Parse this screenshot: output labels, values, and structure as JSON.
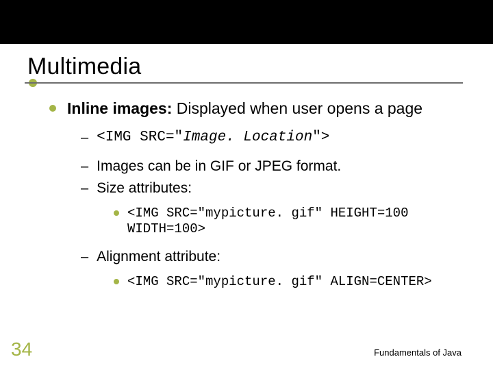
{
  "title": "Multimedia",
  "bullet1": {
    "label": "Inline images:",
    "rest": " Displayed when user opens a page"
  },
  "sub1": {
    "pre": "<IMG SRC=\"",
    "ital": "Image. Location",
    "post": "\">"
  },
  "sub2": "Images can be in GIF or JPEG format.",
  "sub3": "Size attributes:",
  "sub3_code": "<IMG SRC=\"mypicture. gif\" HEIGHT=100 WIDTH=100>",
  "sub4": "Alignment attribute:",
  "sub4_code": "<IMG SRC=\"mypicture. gif\" ALIGN=CENTER>",
  "page_number": "34",
  "footer": "Fundamentals of Java"
}
